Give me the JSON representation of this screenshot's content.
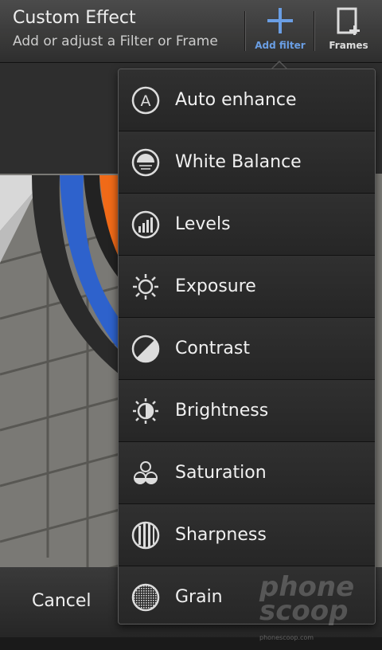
{
  "header": {
    "title": "Custom Effect",
    "subtitle": "Add or adjust a Filter or Frame",
    "add_filter_label": "Add filter",
    "frames_label": "Frames"
  },
  "menu": {
    "items": [
      {
        "label": "Auto enhance",
        "icon": "auto-enhance-icon"
      },
      {
        "label": "White Balance",
        "icon": "white-balance-icon"
      },
      {
        "label": "Levels",
        "icon": "levels-icon"
      },
      {
        "label": "Exposure",
        "icon": "exposure-icon"
      },
      {
        "label": "Contrast",
        "icon": "contrast-icon"
      },
      {
        "label": "Brightness",
        "icon": "brightness-icon"
      },
      {
        "label": "Saturation",
        "icon": "saturation-icon"
      },
      {
        "label": "Sharpness",
        "icon": "sharpness-icon"
      },
      {
        "label": "Grain",
        "icon": "grain-icon"
      }
    ]
  },
  "footer": {
    "cancel_label": "Cancel"
  },
  "watermark": {
    "line1": "phone",
    "line2": "scoop",
    "url": "phonescoop.com"
  },
  "colors": {
    "accent": "#6aa0e8",
    "menu_bg": "#2a2a2a",
    "header_bg": "#3c3c3c"
  }
}
